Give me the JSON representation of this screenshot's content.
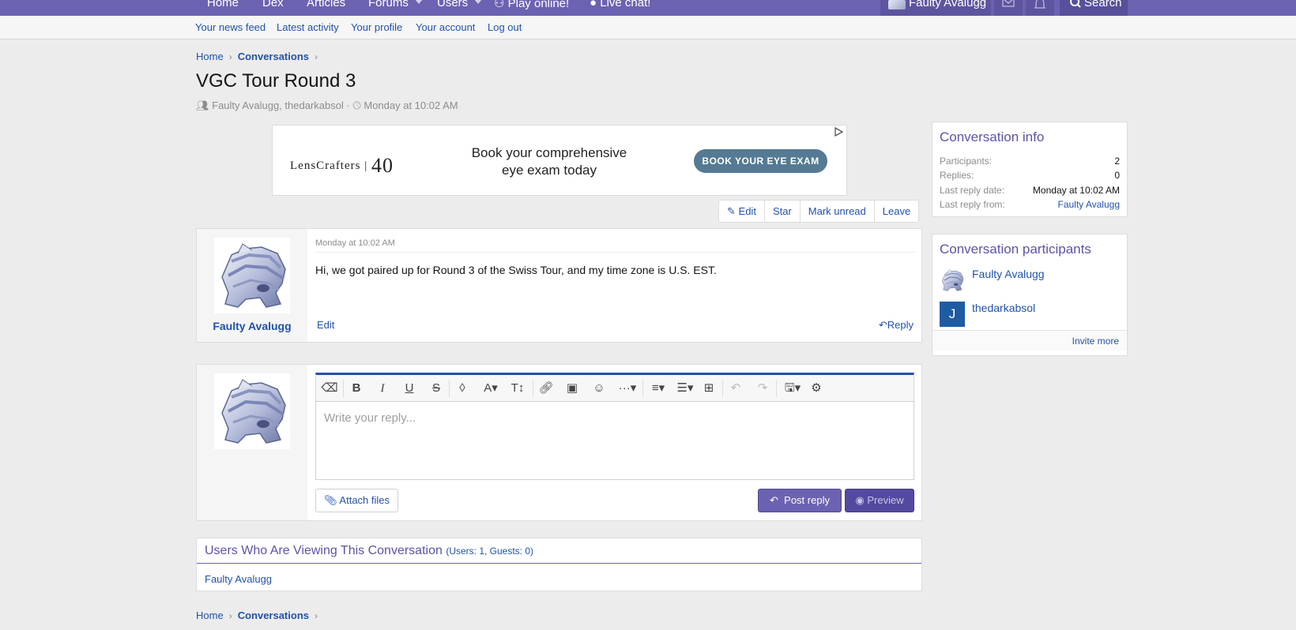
{
  "topnav": {
    "items": [
      "Home",
      "Dex",
      "Articles",
      "Forums",
      "Users",
      "Play online!",
      "Live chat!"
    ],
    "account": "Faulty Avalugg",
    "search": "Search"
  },
  "subnav": [
    "Your news feed",
    "Latest activity",
    "Your profile",
    "Your account",
    "Log out"
  ],
  "breadcrumb": {
    "home": "Home",
    "current": "Conversations"
  },
  "page": {
    "title": "VGC Tour Round 3",
    "participants_meta": "Faulty Avalugg, thedarkabsol",
    "date_meta": "Monday at 10:02 AM"
  },
  "ad": {
    "logo_text": "LensCrafters",
    "logo_num": "40",
    "copy_line1": "Book your comprehensive",
    "copy_line2": "eye exam today",
    "cta": "BOOK YOUR EYE EXAM"
  },
  "actions": {
    "edit": "Edit",
    "star": "Star",
    "mark_unread": "Mark unread",
    "leave": "Leave"
  },
  "message": {
    "author": "Faulty Avalugg",
    "date": "Monday at 10:02 AM",
    "body": "Hi, we got paired up for Round 3 of the Swiss Tour, and my time zone is U.S. EST.",
    "edit": "Edit",
    "reply": "Reply"
  },
  "editor": {
    "placeholder": "Write your reply...",
    "attach": "Attach files",
    "post": "Post reply",
    "preview": "Preview"
  },
  "viewers": {
    "heading": "Users Who Are Viewing This Conversation",
    "counts": "(Users: 1, Guests: 0)",
    "user": "Faulty Avalugg"
  },
  "conv_info": {
    "title": "Conversation info",
    "rows": [
      {
        "label": "Participants:",
        "value": "2"
      },
      {
        "label": "Replies:",
        "value": "0"
      },
      {
        "label": "Last reply date:",
        "value": "Monday at 10:02 AM"
      },
      {
        "label": "Last reply from:",
        "value": "Faulty Avalugg"
      }
    ]
  },
  "conv_participants": {
    "title": "Conversation participants",
    "users": [
      {
        "name": "Faulty Avalugg"
      },
      {
        "name": "thedarkabsol",
        "initial": "J"
      }
    ],
    "invite": "Invite more"
  },
  "colors": {
    "nav": "#6b62b1",
    "link": "#2152a8",
    "heading": "#5b54a5",
    "cta": "#557a93",
    "initial_avatar": "#1f5ba3"
  }
}
